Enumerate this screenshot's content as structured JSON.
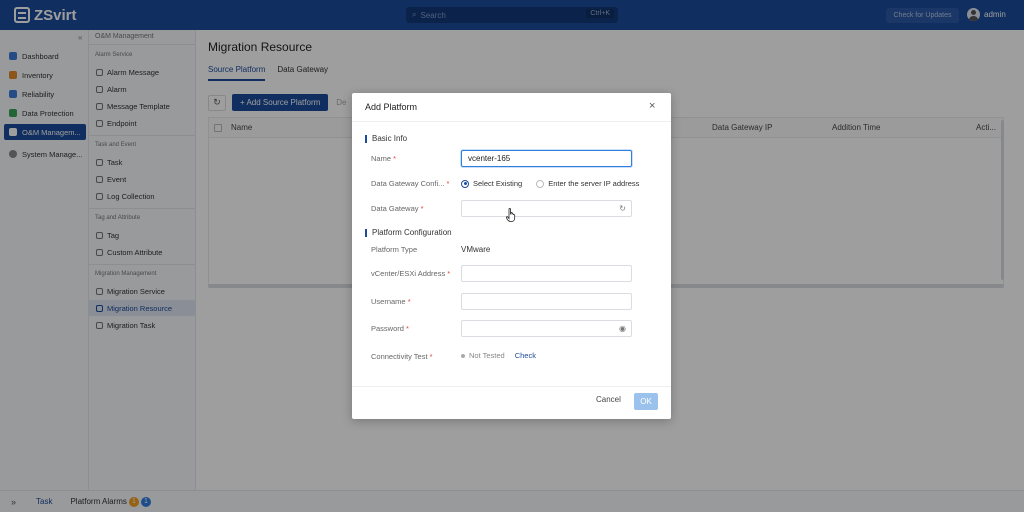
{
  "app": {
    "name": "ZSvirt"
  },
  "topbar": {
    "search_placeholder": "Search",
    "search_shortcut": "Ctrl+K",
    "check_updates": "Check for Updates",
    "user": "admin"
  },
  "nav1": {
    "collapse": "«",
    "items": [
      {
        "label": "Dashboard",
        "icon": "dashboard-icon",
        "color": "#3d7bd9"
      },
      {
        "label": "Inventory",
        "icon": "inventory-icon",
        "color": "#e08a2c"
      },
      {
        "label": "Reliability",
        "icon": "shield-icon",
        "color": "#3d7bd9"
      },
      {
        "label": "Data Protection",
        "icon": "data-protection-icon",
        "color": "#3aa35a"
      },
      {
        "label": "O&M Managem...",
        "icon": "om-icon",
        "color": "#ffffff"
      },
      {
        "label": "System Manage...",
        "icon": "gear-icon",
        "color": "#888888"
      }
    ]
  },
  "nav2": {
    "header": "O&M Management",
    "groups": [
      {
        "title": "Alarm Service",
        "items": [
          "Alarm Message",
          "Alarm",
          "Message Template",
          "Endpoint"
        ]
      },
      {
        "title": "Task and Event",
        "items": [
          "Task",
          "Event",
          "Log Collection"
        ]
      },
      {
        "title": "Tag and Attribute",
        "items": [
          "Tag",
          "Custom Attribute"
        ]
      },
      {
        "title": "Migration Management",
        "items": [
          "Migration Service",
          "Migration Resource",
          "Migration Task"
        ]
      }
    ],
    "active": "Migration Resource"
  },
  "main": {
    "title": "Migration Resource",
    "tabs": [
      "Source Platform",
      "Data Gateway"
    ],
    "add_button": "+ Add Source Platform",
    "delete_button": "De",
    "columns": [
      "Name",
      "Data Gateway IP",
      "Addition Time",
      "Acti..."
    ]
  },
  "bottombar": {
    "chevron": "»",
    "task": "Task",
    "alarms_label": "Platform Alarms",
    "alarm_badges": [
      "1",
      "1"
    ]
  },
  "dialog": {
    "title": "Add Platform",
    "close": "×",
    "basic_info": "Basic Info",
    "name_label": "Name",
    "name_value": "vcenter-165",
    "gateway_config_label": "Data Gateway Confi...",
    "radio_existing": "Select Existing",
    "radio_ip": "Enter the server IP address",
    "gateway_label": "Data Gateway",
    "platform_config": "Platform Configuration",
    "platform_type_label": "Platform Type",
    "platform_type_value": "VMware",
    "address_label": "vCenter/ESXi Address",
    "username_label": "Username",
    "password_label": "Password",
    "connectivity_label": "Connectivity Test",
    "connectivity_status": "Not Tested",
    "check_link": "Check",
    "cancel": "Cancel",
    "ok": "OK",
    "required_mark": "*"
  }
}
